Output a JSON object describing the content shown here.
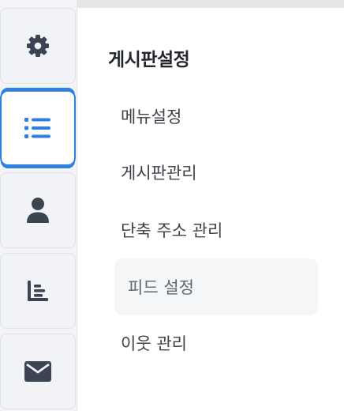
{
  "colors": {
    "accent": "#2f80e0",
    "icon": "#3a4452",
    "rail_background": "#f2f4f6",
    "hover_background": "#f5f6f8"
  },
  "rail": {
    "items": [
      {
        "icon": "gear-icon",
        "active": false
      },
      {
        "icon": "list-icon",
        "active": true
      },
      {
        "icon": "user-icon",
        "active": false
      },
      {
        "icon": "bar-chart-icon",
        "active": false
      },
      {
        "icon": "envelope-icon",
        "active": false
      }
    ]
  },
  "panel": {
    "title": "게시판설정",
    "items": [
      {
        "label": "메뉴설정",
        "state": "normal"
      },
      {
        "label": "게시판관리",
        "state": "normal"
      },
      {
        "label": "단축 주소 관리",
        "state": "normal"
      },
      {
        "label": "피드 설정",
        "state": "hover"
      },
      {
        "label": "이웃 관리",
        "state": "normal"
      }
    ]
  }
}
